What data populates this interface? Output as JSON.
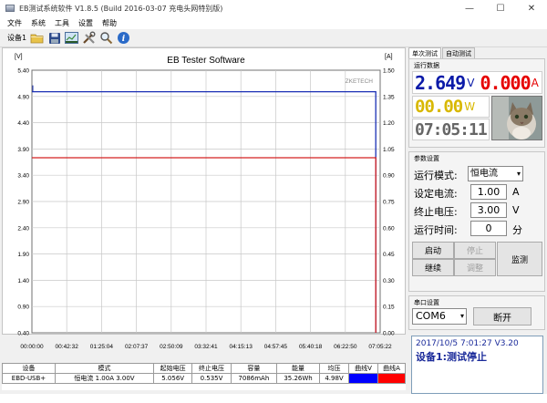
{
  "window": {
    "title": "EB测试系统软件 V1.8.5 (Build 2016-03-07 充电头网特别版)",
    "controls": [
      "—",
      "☐",
      "✕"
    ]
  },
  "menu": [
    "文件",
    "系统",
    "工具",
    "设置",
    "帮助"
  ],
  "toolbar": {
    "device": "设备1"
  },
  "chart": {
    "title": "EB Tester Software",
    "left_unit": "[V]",
    "right_unit": "[A]",
    "left_ticks": [
      "5.40",
      "4.90",
      "4.40",
      "3.90",
      "3.40",
      "2.90",
      "2.40",
      "1.90",
      "1.40",
      "0.90",
      "0.40"
    ],
    "right_ticks": [
      "1.50",
      "1.35",
      "1.20",
      "1.05",
      "0.90",
      "0.75",
      "0.60",
      "0.45",
      "0.30",
      "0.15",
      "0.00"
    ],
    "x_ticks": [
      "00:00:00",
      "00:42:32",
      "01:25:04",
      "02:07:37",
      "02:50:09",
      "03:32:41",
      "04:15:13",
      "04:57:45",
      "05:40:18",
      "06:22:50",
      "07:05:22"
    ],
    "watermark": "ZKETECH"
  },
  "chart_data": {
    "type": "line",
    "title": "EB Tester Software",
    "x": [
      "00:00:00",
      "00:42:32",
      "01:25:04",
      "02:07:37",
      "02:50:09",
      "03:32:41",
      "04:15:13",
      "04:57:45",
      "05:40:18",
      "06:22:50",
      "07:05:22"
    ],
    "xlabel": "",
    "ylabel": "[V]",
    "y2label": "[A]",
    "ylim": [
      0.4,
      5.4
    ],
    "y2lim": [
      0.0,
      1.5
    ],
    "grid": true,
    "series": [
      {
        "name": "曲线V",
        "axis": "left",
        "color": "#1a2fb4",
        "x": [
          "00:00:00",
          "07:00:00"
        ],
        "values": [
          4.99,
          4.99
        ],
        "drop_to_zero_at_end": true
      },
      {
        "name": "曲线A",
        "axis": "right",
        "color": "#d42020",
        "x": [
          "00:00:00",
          "07:00:00"
        ],
        "values": [
          1.0,
          1.0
        ],
        "drop_to_zero_at_end": true
      }
    ]
  },
  "table": {
    "headers": [
      "设备",
      "模式",
      "起始电压",
      "终止电压",
      "容量",
      "能量",
      "均压",
      "曲线V",
      "曲线A"
    ],
    "row": [
      "EBD-USB+",
      "恒电流 1.00A 3.00V",
      "5.056V",
      "0.535V",
      "7086mAh",
      "35.26Wh",
      "4.98V",
      "",
      ""
    ],
    "curve_colors": [
      "#0000ff",
      "#ff0000"
    ]
  },
  "panel": {
    "tabs": [
      "单次测试",
      "自动测试"
    ],
    "run_data_label": "运行数据",
    "voltage": "2.649",
    "voltage_unit": "V",
    "current": "0.000",
    "current_unit": "A",
    "power": "00.00",
    "power_unit": "W",
    "time": "07:05:11",
    "colors": {
      "voltage": "#0a1aa8",
      "current": "#e60000",
      "power": "#d8b800",
      "time": "#666666"
    },
    "params_label": "参数设置",
    "mode_label": "运行模式:",
    "mode_value": "恒电流",
    "set_current_label": "设定电流:",
    "set_current_value": "1.00",
    "set_current_unit": "A",
    "stop_voltage_label": "终止电压:",
    "stop_voltage_value": "3.00",
    "stop_voltage_unit": "V",
    "run_time_label": "运行时间:",
    "run_time_value": "0",
    "run_time_unit": "分",
    "buttons": {
      "start": "启动",
      "stop": "停止",
      "continue": "继续",
      "adjust": "调整",
      "monitor": "监测"
    },
    "serial_label": "串口设置",
    "port_value": "COM6",
    "open_button": "断开"
  },
  "status": {
    "line1": "2017/10/5 7:01:27  V3.20",
    "line2": "设备1:测试停止"
  }
}
